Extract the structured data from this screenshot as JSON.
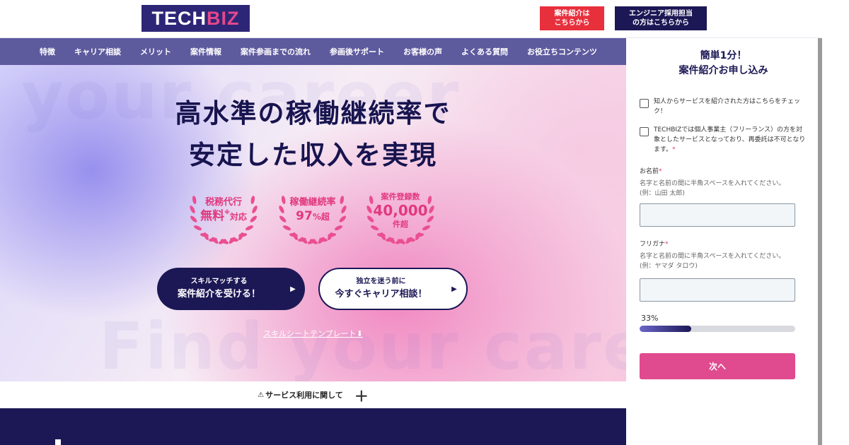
{
  "header": {
    "logo_part1": "TECH",
    "logo_part2": "BIZ",
    "btn_referral_line1": "案件紹介は",
    "btn_referral_line2": "こちらから",
    "btn_recruit_line1": "エンジニア採用担当",
    "btn_recruit_line2": "の方はこちらから"
  },
  "nav": {
    "items": [
      "特徴",
      "キャリア相談",
      "メリット",
      "案件情報",
      "案件参画までの流れ",
      "参画後サポート",
      "お客様の声",
      "よくある質問",
      "お役立ちコンテンツ"
    ]
  },
  "hero": {
    "watermark_top": "your career",
    "watermark_bottom": "Find your care",
    "headline_line1": "高水準の稼働継続率で",
    "headline_line2": "安定した収入を実現",
    "badges": [
      {
        "line1": "税務代行",
        "line2": "無料",
        "suffix": "対応",
        "note": "※"
      },
      {
        "line1": "稼働継続率",
        "line2": "97",
        "suffix": "%超"
      },
      {
        "line1": "案件登録数",
        "line2": "40,000",
        "suffix": "件超"
      }
    ],
    "cta_primary_small": "スキルマッチする",
    "cta_primary_large": "案件紹介を受ける！",
    "cta_secondary_small": "独立を迷う前に",
    "cta_secondary_large": "今すぐキャリア相談！",
    "arrow_icon": "triangle-right",
    "skill_sheet_link": "スキルシートテンプレート",
    "download_icon": "download"
  },
  "notice": {
    "icon": "warning",
    "text": "サービス利用に関して",
    "toggle": "＋"
  },
  "form": {
    "title_line1": "簡単1分！",
    "title_line2": "案件紹介お申し込み",
    "checkbox_referral": "知人からサービスを紹介された方はこちらをチェック！",
    "checkbox_freelance": "TECHBIZでは個人事業主（フリーランス）の方を対象としたサービスとなっており、再委託は不可となります。",
    "required_mark": "*",
    "name_label": "お名前",
    "name_help": "名字と名前の間に半角スペースを入れてください。(例：山田 太郎)",
    "name_value": "",
    "kana_label": "フリガナ",
    "kana_help": "名字と名前の間に半角スペースを入れてください。(例：ヤマダ タロウ)",
    "kana_value": "",
    "progress_label": "33%",
    "progress_value": 0.33,
    "next_button": "次へ"
  },
  "colors": {
    "navy": "#1c1855",
    "logo_bg": "#2d2677",
    "accent_pink": "#e2387e",
    "nav_bg": "#5e5a9e",
    "red": "#e8303d",
    "next_button": "#e04a8e"
  }
}
